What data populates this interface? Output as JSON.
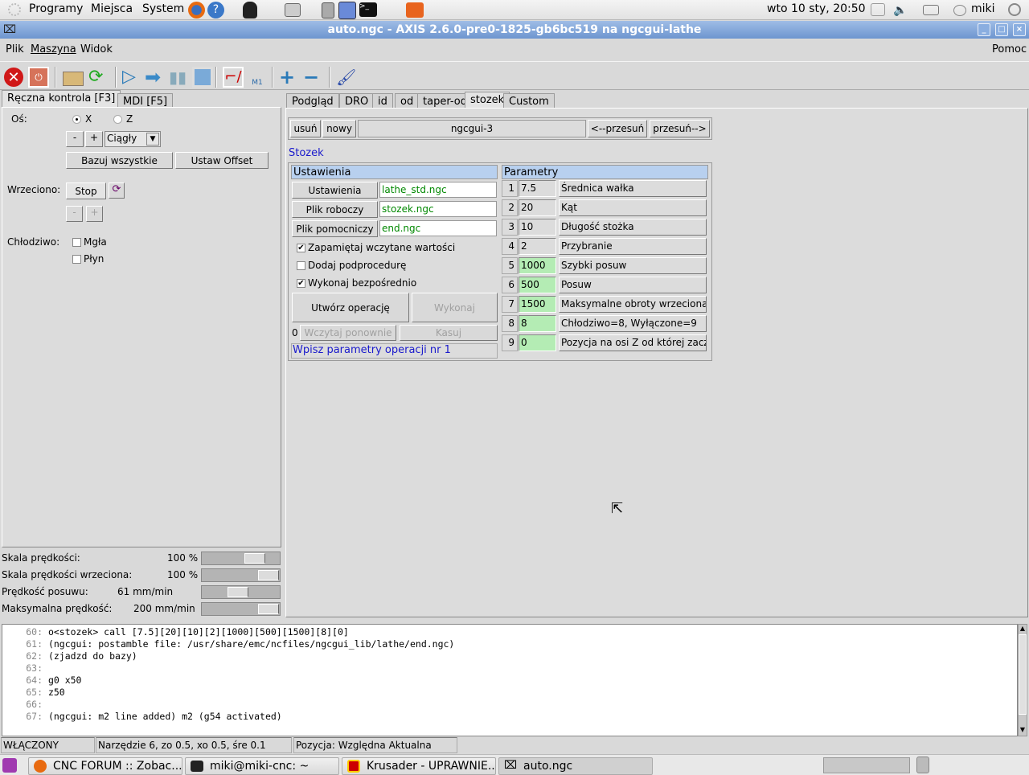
{
  "top_panel": {
    "menus": [
      "Programy",
      "Miejsca",
      "System"
    ],
    "clock": "wto 10 sty, 20:50",
    "user": "miki"
  },
  "window": {
    "title": "auto.ngc - AXIS 2.6.0-pre0-1825-gb6bc519 na ngcgui-lathe"
  },
  "menubar": {
    "items": [
      "Plik",
      "Maszyna",
      "Widok"
    ],
    "help": "Pomoc"
  },
  "toolbar": {
    "icons": [
      "estop-icon",
      "power-icon",
      "open-file-icon",
      "reload-icon",
      "run-icon",
      "step-icon",
      "pause-icon",
      "stop-icon",
      "block-delete-icon",
      "optional-stop-icon",
      "zoom-in-icon",
      "zoom-out-icon",
      "clear-plot-icon"
    ]
  },
  "left": {
    "tabs": [
      "Ręczna kontrola [F3]",
      "MDI [F5]"
    ],
    "axis_label": "Oś:",
    "axis_options": [
      "X",
      "Z"
    ],
    "axis_selected": "X",
    "minus": "-",
    "plus": "+",
    "jog_mode": "Ciągły",
    "home_all": "Bazuj wszystkie",
    "touch_off": "Ustaw Offset",
    "spindle_label": "Wrzeciono:",
    "spindle_stop": "Stop",
    "coolant_label": "Chłodziwo:",
    "mist": "Mgła",
    "flood": "Płyn"
  },
  "sliders": [
    {
      "label": "Skala prędkości:",
      "value": "100 %",
      "fraction": 0.75
    },
    {
      "label": "Skala prędkości wrzeciona:",
      "value": "100 %",
      "fraction": 1.0
    },
    {
      "label": "Prędkość posuwu:",
      "value": "61 mm/min",
      "fraction": 0.45
    },
    {
      "label": "Maksymalna prędkość:",
      "value": "200 mm/min",
      "fraction": 1.0
    }
  ],
  "right": {
    "tabs": [
      "Podgląd",
      "DRO",
      "id",
      "od",
      "taper-od",
      "stozek",
      "Custom"
    ],
    "active_tab": "stozek",
    "remove": "usuń",
    "new": "nowy",
    "page_name": "ngcgui-3",
    "move_left": "<--przesuń",
    "move_right": "przesuń-->",
    "subroutine_title": "Stozek",
    "settings_header": "Ustawienia",
    "files": [
      {
        "button": "Ustawienia",
        "value": "lathe_std.ngc"
      },
      {
        "button": "Plik roboczy",
        "value": "stozek.ngc"
      },
      {
        "button": "Plik pomocniczy",
        "value": "end.ngc"
      }
    ],
    "options": [
      {
        "label": "Zapamiętaj wczytane wartości",
        "checked": true
      },
      {
        "label": "Dodaj podprocedurę",
        "checked": false
      },
      {
        "label": "Wykonaj bezpośrednio",
        "checked": true
      }
    ],
    "create_op": "Utwórz operację",
    "execute": "Wykonaj",
    "counter": "0",
    "reload": "Wczytaj ponownie",
    "delete": "Kasuj",
    "hint": "Wpisz parametry operacji nr 1",
    "params_header": "Parametry",
    "params": [
      {
        "n": "1",
        "value": "7.5",
        "desc": "Średnica wałka",
        "modified": false
      },
      {
        "n": "2",
        "value": "20",
        "desc": "Kąt",
        "modified": false
      },
      {
        "n": "3",
        "value": "10",
        "desc": "Długość stożka",
        "modified": false
      },
      {
        "n": "4",
        "value": "2",
        "desc": "Przybranie",
        "modified": false
      },
      {
        "n": "5",
        "value": "1000",
        "desc": "Szybki posuw",
        "modified": true
      },
      {
        "n": "6",
        "value": "500",
        "desc": "Posuw",
        "modified": true
      },
      {
        "n": "7",
        "value": "1500",
        "desc": "Maksymalne obroty wrzeciona",
        "modified": true
      },
      {
        "n": "8",
        "value": "8",
        "desc": "Chłodziwo=8, Wyłączone=9",
        "modified": true
      },
      {
        "n": "9",
        "value": "0",
        "desc": "Pozycja na osi Z od której zacząć",
        "modified": true
      }
    ]
  },
  "gcode": [
    {
      "n": "60:",
      "text": "o<stozek> call [7.5][20][10][2][1000][500][1500][8][0]"
    },
    {
      "n": "61:",
      "text": "(ngcgui: postamble file: /usr/share/emc/ncfiles/ngcgui_lib/lathe/end.ngc)"
    },
    {
      "n": "62:",
      "text": "(zjadzd do bazy)"
    },
    {
      "n": "63:",
      "text": ""
    },
    {
      "n": "64:",
      "text": "g0 x50"
    },
    {
      "n": "65:",
      "text": "z50"
    },
    {
      "n": "66:",
      "text": ""
    },
    {
      "n": "67:",
      "text": "(ngcgui: m2 line added) m2 (g54 activated)"
    }
  ],
  "statusbar": {
    "state": "WŁĄCZONY",
    "tool": "Narzędzie 6, zo 0.5, xo 0.5, śre 0.1",
    "position": "Pozycja: Względna Aktualna"
  },
  "taskbar": [
    {
      "label": "CNC FORUM :: Zobac..."
    },
    {
      "label": "miki@miki-cnc: ~"
    },
    {
      "label": "Krusader - UPRAWNIE..."
    },
    {
      "label": "auto.ngc"
    }
  ],
  "colors": {
    "param_modified": "#b4ecb4",
    "param_default": "#dcdcdc",
    "file_entry_text": "#008800",
    "link_blue": "#1a1acc",
    "header_bg": "#b8d0ef"
  }
}
